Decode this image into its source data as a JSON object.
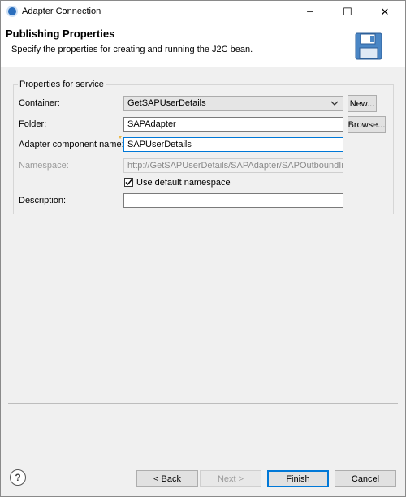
{
  "window": {
    "title": "Adapter Connection",
    "controls": {
      "minimize": "─",
      "maximize": "☐",
      "close": "✕"
    }
  },
  "header": {
    "title": "Publishing Properties",
    "description": "Specify the properties for creating and running the J2C bean."
  },
  "group": {
    "legend": "Properties for service",
    "container": {
      "label": "Container:",
      "value": "GetSAPUserDetails",
      "new_button": "New..."
    },
    "folder": {
      "label": "Folder:",
      "value": "SAPAdapter",
      "browse_button": "Browse..."
    },
    "adapter_name": {
      "label": "Adapter component name:",
      "required_mark": "*",
      "value": "SAPUserDetails"
    },
    "namespace": {
      "label": "Namespace:",
      "value": "http://GetSAPUserDetails/SAPAdapter/SAPOutboundInterf"
    },
    "use_default_namespace": {
      "label": "Use default namespace",
      "checked": true
    },
    "description": {
      "label": "Description:",
      "value": ""
    }
  },
  "footer": {
    "help_icon": "?",
    "back": "< Back",
    "next": "Next >",
    "finish": "Finish",
    "cancel": "Cancel"
  },
  "colors": {
    "accent": "#0078d7",
    "required": "#e8a000",
    "background": "#f0f0f0"
  }
}
